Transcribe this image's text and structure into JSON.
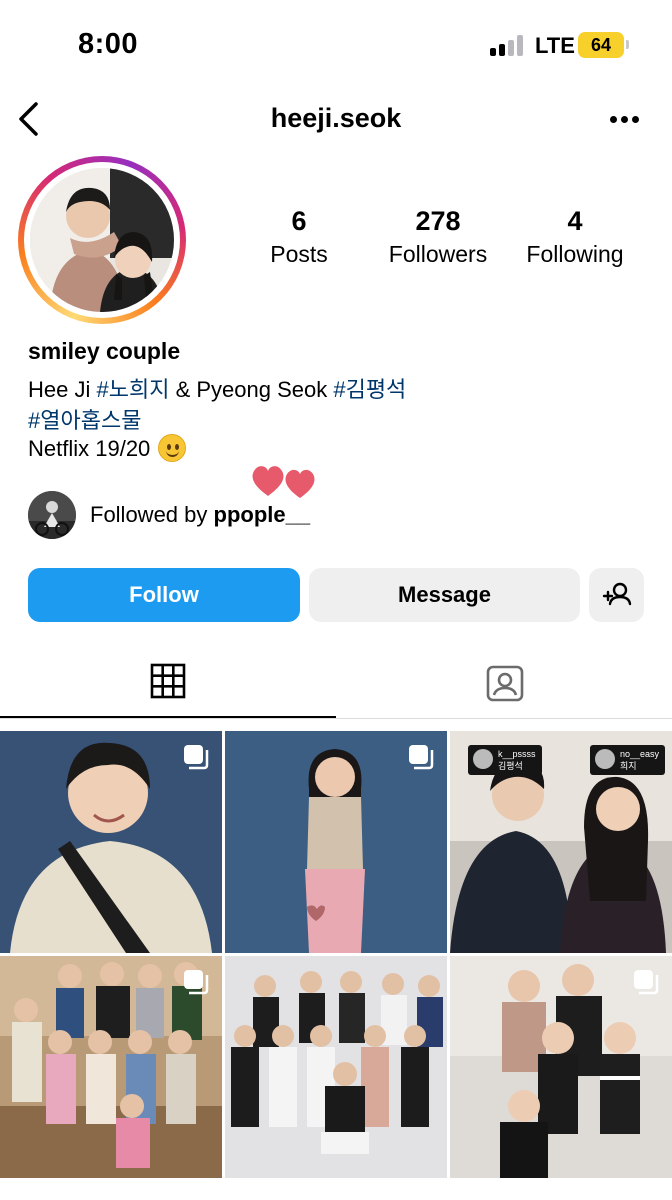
{
  "status_bar": {
    "time": "8:00",
    "network": "LTE",
    "battery": "64",
    "battery_color": "#f7d02c"
  },
  "header": {
    "username": "heeji.seok",
    "back_icon": "chevron-left-icon",
    "more_icon": "ellipsis-icon"
  },
  "stats": [
    {
      "value": "6",
      "label": "Posts"
    },
    {
      "value": "278",
      "label": "Followers"
    },
    {
      "value": "4",
      "label": "Following"
    }
  ],
  "bio": {
    "name": "smiley couple",
    "line1_prefix": "Hee Ji ",
    "line1_tag1": "#노희지",
    "line1_middle": " & Pyeong Seok ",
    "line1_tag2": "#김평석",
    "line2_tag": "#열아홉스물",
    "line3": "Netflix 19/20",
    "emoji": "smiling-face-icon"
  },
  "followed_by": {
    "prefix": "Followed by ",
    "username": "ppople__"
  },
  "actions": {
    "follow_label": "Follow",
    "message_label": "Message",
    "add_user_icon": "add-person-icon"
  },
  "colors": {
    "follow_button": "#1c9bf0",
    "secondary_button": "#efefef",
    "hashtag": "#00376b"
  },
  "tabs": [
    {
      "icon": "grid-icon",
      "active": true
    },
    {
      "icon": "tagged-person-icon",
      "active": false
    }
  ],
  "posts": [
    {
      "icon": "multiple-posts-icon"
    },
    {
      "icon": "multiple-posts-icon"
    },
    {
      "story_tags": [
        {
          "handle": "k__pssss",
          "name": "김평석"
        },
        {
          "handle": "no__easy",
          "name": "희지"
        }
      ]
    },
    {
      "icon": "multiple-posts-icon"
    },
    {
      "icon": "none"
    },
    {
      "icon": "multiple-posts-icon"
    }
  ]
}
